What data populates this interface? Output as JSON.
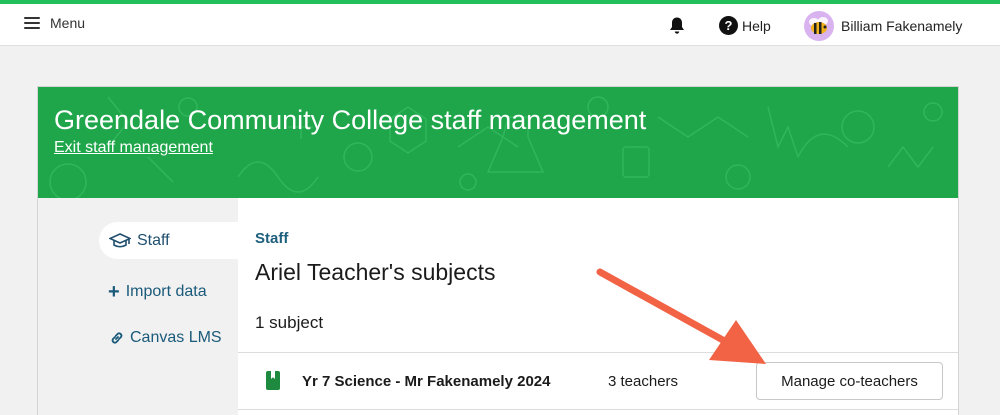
{
  "navbar": {
    "menu_label": "Menu",
    "help_label": "Help",
    "help_icon_glyph": "?",
    "user_name": "Billiam Fakenamely"
  },
  "banner": {
    "title": "Greendale Community College staff management",
    "exit_link": "Exit staff management"
  },
  "sidebar": {
    "items": [
      {
        "label": "Staff",
        "icon": "graduation-cap-icon",
        "active": true
      },
      {
        "label": "Import data",
        "icon": "plus-icon",
        "active": false
      },
      {
        "label": "Canvas LMS",
        "icon": "link-icon",
        "active": false
      }
    ]
  },
  "main": {
    "breadcrumb": "Staff",
    "heading": "Ariel Teacher's subjects",
    "subject_count": "1 subject",
    "subjects": [
      {
        "name": "Yr 7 Science - Mr Fakenamely 2024",
        "icon": "book-icon",
        "teachers": "3 teachers",
        "action": "Manage co-teachers"
      }
    ]
  },
  "colors": {
    "accent_green": "#1fa64a",
    "top_line": "#21c05a",
    "link_blue": "#1d5f7d",
    "annotation_arrow": "#f26346"
  }
}
